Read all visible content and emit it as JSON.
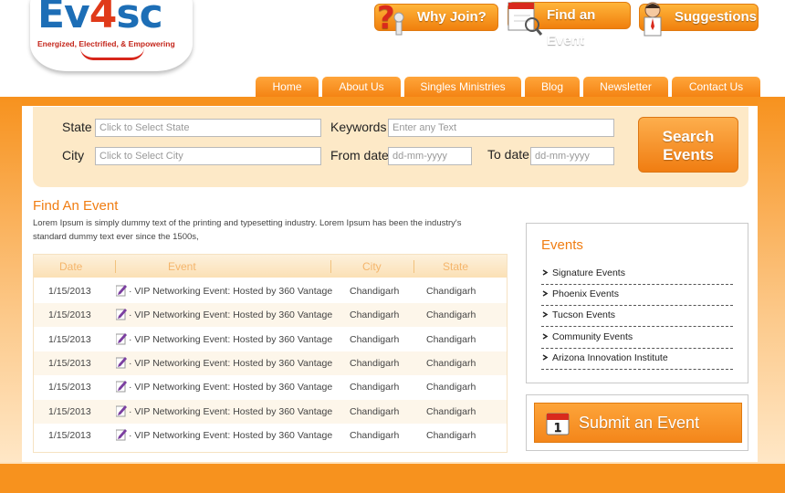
{
  "logo": {
    "part1": "Ev",
    "part2": "4",
    "part3": "sc",
    "tagline": "Energized, Electrified, & Empowering"
  },
  "top_buttons": {
    "why_join": "Why Join?",
    "find_event": "Find an Event",
    "suggestions": "Suggestions"
  },
  "nav": [
    "Home",
    "About Us",
    "Singles Ministries",
    "Blog",
    "Newsletter",
    "Contact Us"
  ],
  "search": {
    "state_label": "State",
    "state_placeholder": "Click to Select State",
    "city_label": "City",
    "city_placeholder": "Click to Select City",
    "keywords_label": "Keywords",
    "keywords_placeholder": "Enter any Text",
    "from_label": "From date",
    "from_placeholder": "dd-mm-yyyy",
    "to_label": "To date",
    "to_placeholder": "dd-mm-yyyy",
    "button_line1": "Search",
    "button_line2": "Events"
  },
  "find_event": {
    "title": "Find An Event",
    "description": "Lorem Ipsum is simply dummy text of the printing and typesetting industry. Lorem Ipsum has been the industry's standard dummy text ever since the 1500s,"
  },
  "table": {
    "headers": [
      "Date",
      "Event",
      "City",
      "State"
    ],
    "rows": [
      {
        "date": "1/15/2013",
        "event": "· VIP Networking Event: Hosted by 360 Vantage",
        "city": "Chandigarh",
        "state": "Chandigarh"
      },
      {
        "date": "1/15/2013",
        "event": "· VIP Networking Event: Hosted by 360 Vantage",
        "city": "Chandigarh",
        "state": "Chandigarh"
      },
      {
        "date": "1/15/2013",
        "event": "· VIP Networking Event: Hosted by 360 Vantage",
        "city": "Chandigarh",
        "state": "Chandigarh"
      },
      {
        "date": "1/15/2013",
        "event": "· VIP Networking Event: Hosted by 360 Vantage",
        "city": "Chandigarh",
        "state": "Chandigarh"
      },
      {
        "date": "1/15/2013",
        "event": "· VIP Networking Event: Hosted by 360 Vantage",
        "city": "Chandigarh",
        "state": "Chandigarh"
      },
      {
        "date": "1/15/2013",
        "event": "· VIP Networking Event: Hosted by 360 Vantage",
        "city": "Chandigarh",
        "state": "Chandigarh"
      },
      {
        "date": "1/15/2013",
        "event": "· VIP Networking Event: Hosted by 360 Vantage",
        "city": "Chandigarh",
        "state": "Chandigarh"
      }
    ]
  },
  "events_box": {
    "title": "Events",
    "items": [
      "Signature Events",
      "Phoenix Events",
      "Tucson Events",
      "Community Events",
      "Arizona Innovation Institute"
    ]
  },
  "submit": {
    "label": "Submit an Event",
    "calendar_day": "1"
  },
  "colors": {
    "accent": "#f7921e",
    "title_orange": "#f07d12",
    "panel_bg": "#fde9c7"
  }
}
